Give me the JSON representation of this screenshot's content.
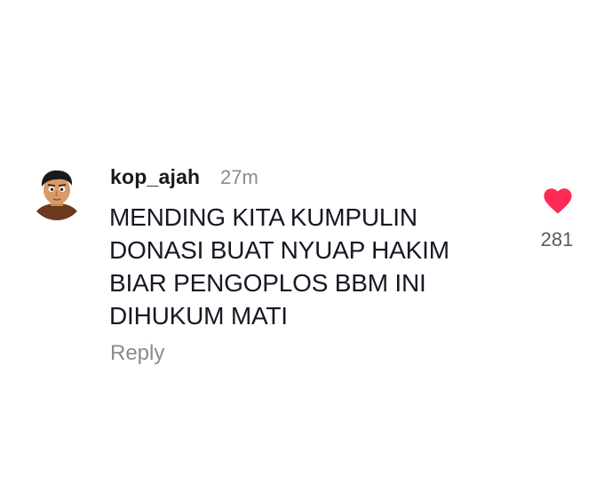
{
  "comment": {
    "username": "kop_ajah",
    "timestamp": "27m",
    "text_lines": [
      "MENDING KITA KUMPULIN",
      "DONASI BUAT NYUAP HAKIM",
      "BIAR PENGOPLOS BBM INI",
      "DIHUKUM MATI"
    ],
    "reply_label": "Reply",
    "like_count": "281",
    "like_icon": "heart-icon",
    "like_color": "#fe2c55"
  }
}
